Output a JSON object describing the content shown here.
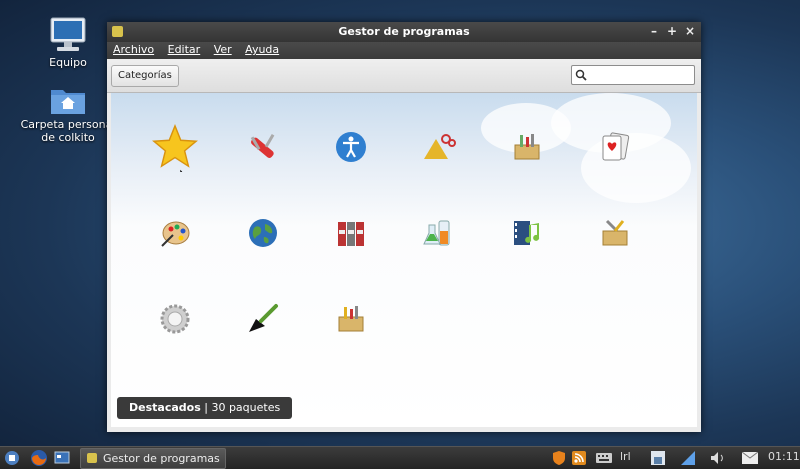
{
  "desktop": {
    "icons": [
      {
        "label": "Equipo"
      },
      {
        "label": "Carpeta personal de colkito"
      }
    ]
  },
  "window": {
    "title": "Gestor de programas",
    "controls": {
      "minimize": "–",
      "maximize": "+",
      "close": "×"
    },
    "menu": [
      "Archivo",
      "Editar",
      "Ver",
      "Ayuda"
    ],
    "categories_button": "Categorías",
    "search_placeholder": "",
    "icons": [
      "star-icon",
      "tools-knife-icon",
      "accessibility-icon",
      "education-icon",
      "toolbox-icon",
      "cards-game-icon",
      "paint-palette-icon",
      "globe-icon",
      "books-icon",
      "science-icon",
      "multimedia-icon",
      "settings-tools-icon",
      "system-gear-icon",
      "trowel-icon",
      "crate-icon"
    ],
    "status": {
      "bold": "Destacados",
      "sep": " | ",
      "rest": "30 paquetes"
    }
  },
  "taskbar": {
    "task_label": "Gestor de programas",
    "keyboard_layout": "lrl",
    "clock": "01:11"
  },
  "colors": {
    "accent": "#d8c24c",
    "titlebar": "#3a3a3a",
    "status_bg": "#3a3a3a"
  }
}
